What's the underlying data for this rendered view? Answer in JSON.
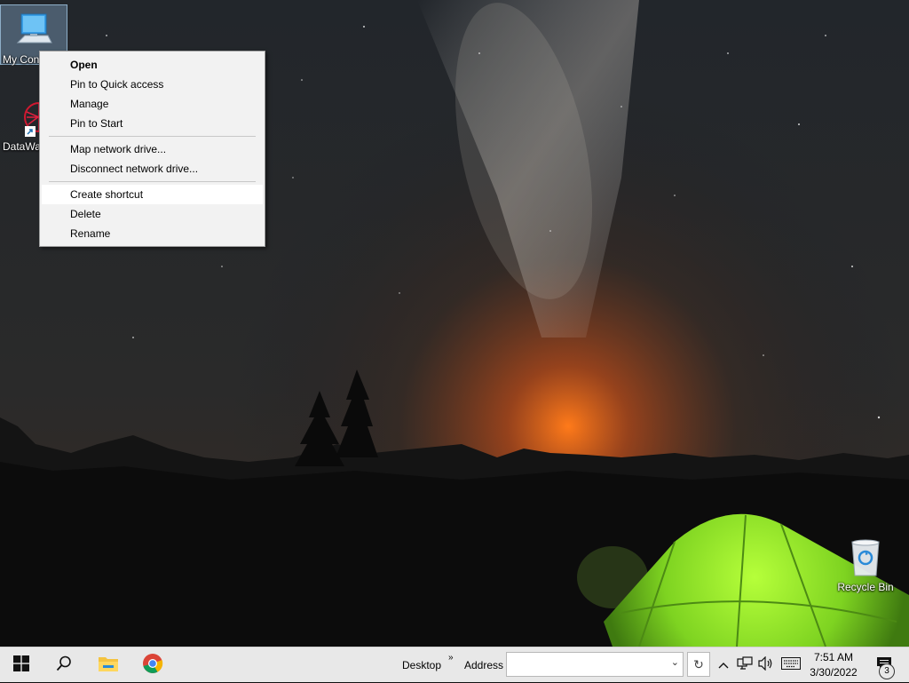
{
  "desktop": {
    "icons": [
      {
        "label": "My Con",
        "icon": "computer-monitor-icon"
      },
      {
        "label": "DataWa",
        "icon": "red-sphere-shortcut-icon"
      },
      {
        "label": "Recycle Bin",
        "icon": "recycle-bin-icon"
      }
    ]
  },
  "context_menu": {
    "groups": [
      [
        {
          "label": "Open",
          "bold": true
        },
        {
          "label": "Pin to Quick access"
        },
        {
          "label": "Manage"
        },
        {
          "label": "Pin to Start"
        }
      ],
      [
        {
          "label": "Map network drive..."
        },
        {
          "label": "Disconnect network drive..."
        }
      ],
      [
        {
          "label": "Create shortcut",
          "highlighted": true
        },
        {
          "label": "Delete"
        },
        {
          "label": "Rename"
        }
      ]
    ]
  },
  "taskbar": {
    "start_icon": "windows-logo-icon",
    "search_icon": "search-icon",
    "pinned": [
      "file-explorer-icon",
      "chrome-icon"
    ],
    "toolbar_desktop": "Desktop",
    "toolbar_chevron": "»",
    "address_label": "Address",
    "address_value": "",
    "tray": [
      "chevron-up-icon",
      "network-icon",
      "volume-icon",
      "keyboard-icon"
    ],
    "clock_time": "7:51 AM",
    "clock_date": "3/30/2022",
    "notification_count": "3"
  },
  "colors": {
    "taskbar_bg": "#e8e8e8",
    "menu_bg": "#f2f2f2",
    "tent_green": "#7ed321",
    "horizon_glow": "#e8601c"
  }
}
